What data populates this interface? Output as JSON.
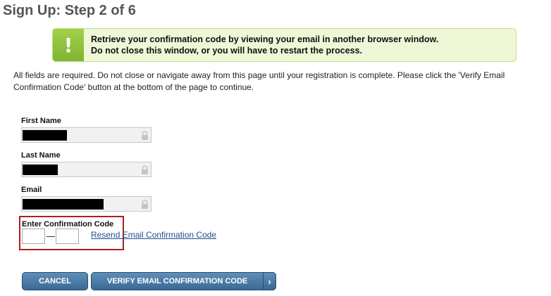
{
  "page": {
    "title": "Sign Up: Step 2 of 6"
  },
  "alert": {
    "icon": "exclamation-icon",
    "line1": "Retrieve your confirmation code by viewing your email in another browser window.",
    "line2": "Do not close this window, or you will have to restart the process."
  },
  "intro": "All fields are required. Do not close or navigate away from this page until your registration is complete. Please click the 'Verify Email Confirmation Code' button at the bottom of the page to continue.",
  "fields": {
    "first_name": {
      "label": "First Name",
      "value_redacted": true,
      "locked": true
    },
    "last_name": {
      "label": "Last Name",
      "value_redacted": true,
      "locked": true
    },
    "email": {
      "label": "Email",
      "value_redacted": true,
      "locked": true
    }
  },
  "confirmation": {
    "label": "Enter Confirmation Code",
    "part1": "",
    "part2": "",
    "resend_link": "Resend Email Confirmation Code"
  },
  "buttons": {
    "cancel": "CANCEL",
    "verify": "VERIFY EMAIL CONFIRMATION CODE",
    "verify_arrow": "›"
  },
  "colors": {
    "title": "#555555",
    "alert_bg": "#eef7d6",
    "alert_icon": "#8cc43c",
    "highlight_border": "#b01e1e",
    "button": "#4a7aa4",
    "link": "#1f4f8a"
  }
}
